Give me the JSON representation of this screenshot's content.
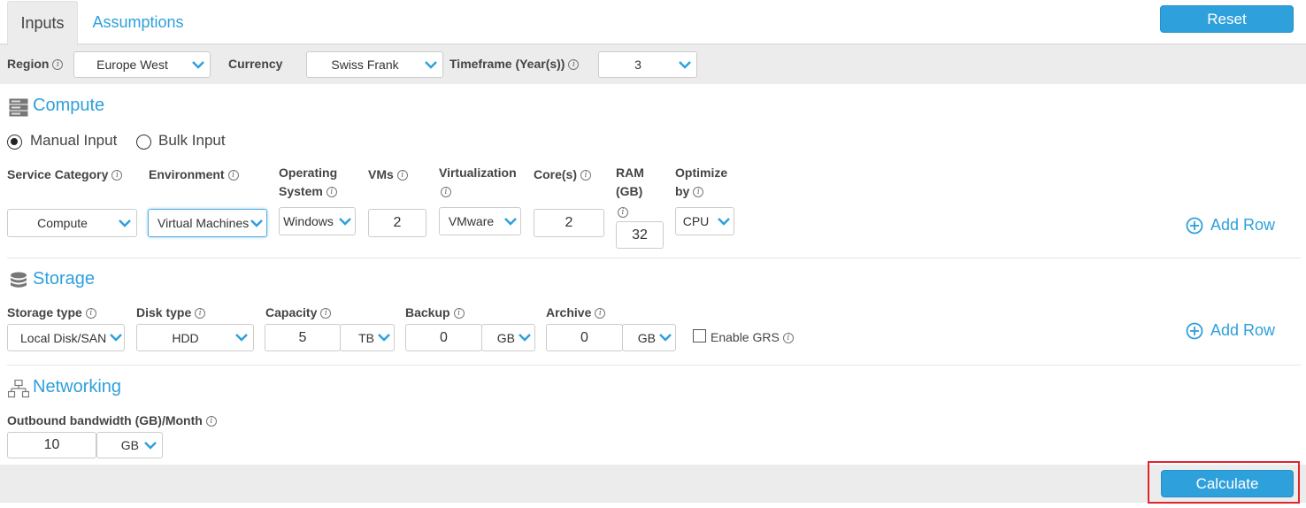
{
  "tabs": {
    "inputs": "Inputs",
    "assumptions": "Assumptions"
  },
  "reset_label": "Reset",
  "calculate_label": "Calculate",
  "filters": {
    "region_label": "Region",
    "region_value": "Europe West",
    "currency_label": "Currency",
    "currency_value": "Swiss Frank",
    "timeframe_label": "Timeframe (Year(s))",
    "timeframe_value": "3"
  },
  "compute": {
    "title": "Compute",
    "manual_input": "Manual Input",
    "bulk_input": "Bulk Input",
    "service_category_label": "Service Category",
    "service_category_value": "Compute",
    "environment_label": "Environment",
    "environment_value": "Virtual Machines",
    "os_label_1": "Operating",
    "os_label_2": "System",
    "os_value": "Windows",
    "vms_label": "VMs",
    "vms_value": "2",
    "virtualization_label": "Virtualization",
    "virtualization_value": "VMware",
    "cores_label": "Core(s)",
    "cores_value": "2",
    "ram_label_1": "RAM",
    "ram_label_2": "(GB)",
    "ram_value": "32",
    "optimize_label_1": "Optimize",
    "optimize_label_2": "by",
    "optimize_value": "CPU",
    "add_row": "Add Row"
  },
  "storage": {
    "title": "Storage",
    "storage_type_label": "Storage type",
    "storage_type_value": "Local Disk/SAN",
    "disk_type_label": "Disk type",
    "disk_type_value": "HDD",
    "capacity_label": "Capacity",
    "capacity_value": "5",
    "capacity_unit": "TB",
    "backup_label": "Backup",
    "backup_value": "0",
    "backup_unit": "GB",
    "archive_label": "Archive",
    "archive_value": "0",
    "archive_unit": "GB",
    "enable_grs": "Enable GRS",
    "add_row": "Add Row"
  },
  "networking": {
    "title": "Networking",
    "outbound_label": "Outbound bandwidth (GB)/Month",
    "outbound_value": "10",
    "outbound_unit": "GB"
  },
  "colors": {
    "accent": "#2ea0dc",
    "toolbar_bg": "#ececec",
    "highlight": "#e0262b"
  },
  "icons": [
    "info-icon",
    "chevron-down-icon",
    "server-icon",
    "database-icon",
    "network-icon",
    "plus-circle-icon"
  ]
}
